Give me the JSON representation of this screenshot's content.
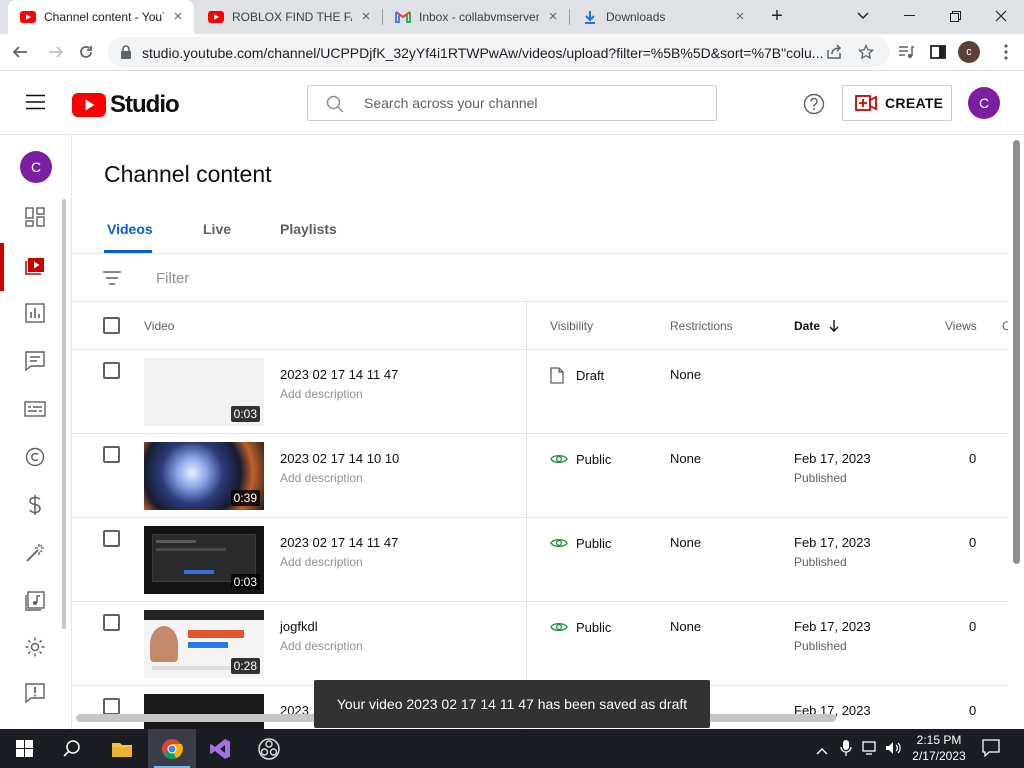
{
  "browser": {
    "tabs": [
      {
        "title": "Channel content - YouTube Studio",
        "icon": "youtube-icon",
        "active": true
      },
      {
        "title": "ROBLOX FIND THE FAMILY",
        "icon": "youtube-icon",
        "active": false
      },
      {
        "title": "Inbox - collabvmserver",
        "icon": "gmail-icon",
        "active": false
      },
      {
        "title": "Downloads",
        "icon": "download-icon",
        "active": false
      }
    ],
    "url": "studio.youtube.com/channel/UCPPDjfK_32yYf4i1RTWPwAw/videos/upload?filter=%5B%5D&sort=%7B\"colu...",
    "profile_initial": "c"
  },
  "header": {
    "logo_text": "Studio",
    "search_placeholder": "Search across your channel",
    "create_label": "CREATE",
    "avatar_initial": "C"
  },
  "sidebar": {
    "avatar_initial": "C"
  },
  "main": {
    "title": "Channel content",
    "tabs": [
      {
        "label": "Videos",
        "active": true
      },
      {
        "label": "Live",
        "active": false
      },
      {
        "label": "Playlists",
        "active": false
      }
    ],
    "filter_label": "Filter",
    "columns": {
      "video": "Video",
      "visibility": "Visibility",
      "restrictions": "Restrictions",
      "date": "Date",
      "views": "Views",
      "comments_partial": "C"
    },
    "rows": [
      {
        "title": "2023 02 17 14 11 47",
        "description": "Add description",
        "duration": "0:03",
        "visibility": "Draft",
        "restrictions": "None",
        "date": "",
        "date_status": "",
        "views": ""
      },
      {
        "title": "2023 02 17 14 10 10",
        "description": "Add description",
        "duration": "0:39",
        "visibility": "Public",
        "restrictions": "None",
        "date": "Feb 17, 2023",
        "date_status": "Published",
        "views": "0"
      },
      {
        "title": "2023 02 17 14 11 47",
        "description": "Add description",
        "duration": "0:03",
        "visibility": "Public",
        "restrictions": "None",
        "date": "Feb 17, 2023",
        "date_status": "Published",
        "views": "0"
      },
      {
        "title": "jogfkdl",
        "description": "Add description",
        "duration": "0:28",
        "visibility": "Public",
        "restrictions": "None",
        "date": "Feb 17, 2023",
        "date_status": "Published",
        "views": "0"
      },
      {
        "title": "2023",
        "description": "",
        "duration": "",
        "visibility": "",
        "restrictions": "",
        "date": "Feb 17, 2023",
        "date_status": "",
        "views": "0"
      }
    ]
  },
  "toast": "Your video 2023 02 17 14 11 47 has been saved as draft",
  "taskbar": {
    "time": "2:15 PM",
    "date": "2/17/2023"
  },
  "colors": {
    "accent_blue": "#065fd4",
    "youtube_red": "#ff0000",
    "avatar_purple": "#7b1fa2",
    "active_nav_red": "#cc0000"
  }
}
